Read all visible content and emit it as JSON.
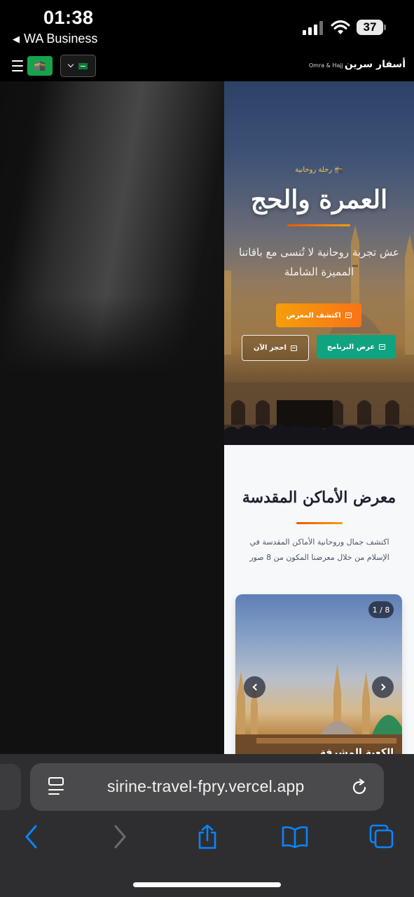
{
  "status_bar": {
    "time": "01:38",
    "back_app": "WA Business",
    "battery": "37"
  },
  "header": {
    "brand_name": "أسفار سرين",
    "brand_tagline": "Omra & Hajj",
    "lang_icon": "🕋",
    "menu_icon": "hamburger-icon",
    "country_flag": "saudi-flag-icon"
  },
  "hero": {
    "badge_icon": "🕋",
    "badge": "رحلة روحانية",
    "title": "العمرة والحج",
    "subtitle": "عش تجربة روحانية لا تُنسى مع باقاتنا المميزة الشاملة",
    "buttons": {
      "gallery": "اكتشف المعرض",
      "program": "عرض البرنامج",
      "book": "احجز الآن"
    }
  },
  "gallery": {
    "title": "معرض الأماكن المقدسة",
    "description": "اكتشف جمال وروحانية الأماكن المقدسة في الإسلام من خلال معرضنا المكون من 8 صور",
    "counter": "1 / 8",
    "caption": "الكعبة المشرفة"
  },
  "browser": {
    "url": "sirine-travel-fpry.vercel.app"
  },
  "colors": {
    "accent_orange": "#f59e0b",
    "accent_green": "#10a37f",
    "ios_blue": "#0a84ff"
  }
}
